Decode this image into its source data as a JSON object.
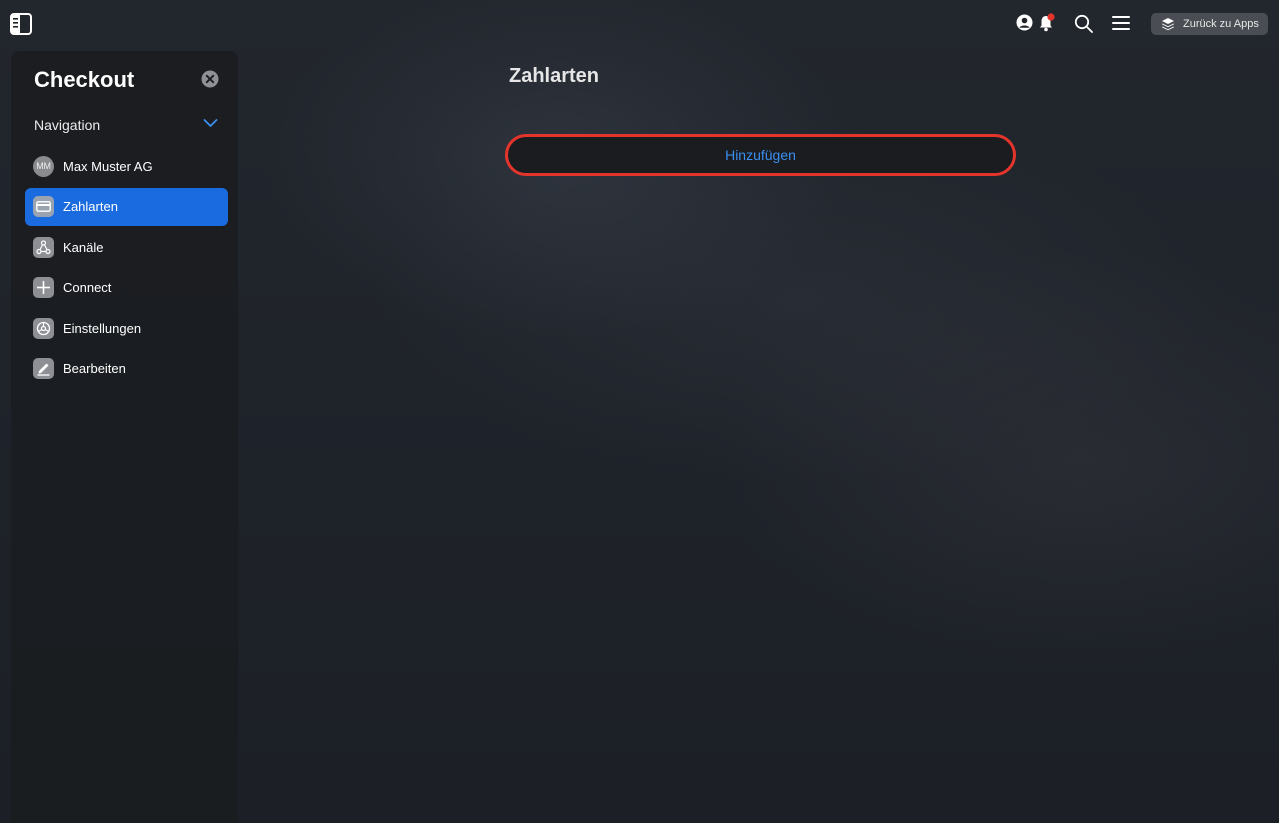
{
  "header": {
    "sidebar_toggle_icon": "sidebar-toggle-icon",
    "icons": [
      "user-icon",
      "bell-icon",
      "search-icon",
      "hamburger-menu-icon"
    ],
    "notification_dot_color": "#e3352b",
    "back_button_label": "Zurück zu Apps"
  },
  "sidebar": {
    "title": "Checkout",
    "nav_header": "Navigation",
    "items": [
      {
        "label": "Max Muster AG",
        "icon": "avatar",
        "avatar_text": "MM",
        "active": false
      },
      {
        "label": "Zahlarten",
        "icon": "credit-card-icon",
        "active": true
      },
      {
        "label": "Kanäle",
        "icon": "channels-icon",
        "active": false
      },
      {
        "label": "Connect",
        "icon": "plus-icon",
        "active": false
      },
      {
        "label": "Einstellungen",
        "icon": "settings-icon",
        "active": false
      },
      {
        "label": "Bearbeiten",
        "icon": "edit-icon",
        "active": false
      }
    ]
  },
  "main": {
    "title": "Zahlarten",
    "add_button_label": "Hinzufügen"
  },
  "colors": {
    "accent": "#1a6be0",
    "link": "#3b8ff0",
    "highlight_border": "#e3352b"
  }
}
